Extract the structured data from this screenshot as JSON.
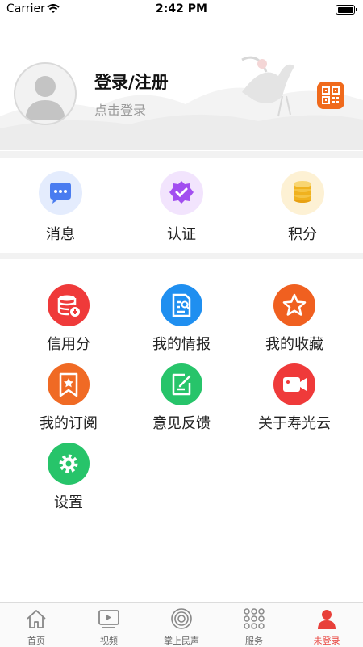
{
  "status_bar": {
    "carrier": "Carrier",
    "time": "2:42 PM"
  },
  "profile": {
    "title": "登录/注册",
    "subtitle": "点击登录"
  },
  "quick_actions": [
    {
      "label": "消息",
      "icon": "chat-bubble-icon",
      "color": "#4a7cf0"
    },
    {
      "label": "认证",
      "icon": "verified-badge-icon",
      "color": "#a24ef0"
    },
    {
      "label": "积分",
      "icon": "coins-icon",
      "color": "#f0b21e"
    }
  ],
  "grid_items": [
    {
      "label": "信用分",
      "icon": "database-icon",
      "color": "#ef3a3a"
    },
    {
      "label": "我的情报",
      "icon": "document-search-icon",
      "color": "#1f8ff0"
    },
    {
      "label": "我的收藏",
      "icon": "star-icon",
      "color": "#f06020"
    },
    {
      "label": "我的订阅",
      "icon": "bookmark-star-icon",
      "color": "#f06a24"
    },
    {
      "label": "意见反馈",
      "icon": "edit-note-icon",
      "color": "#27c46a"
    },
    {
      "label": "关于寿光云",
      "icon": "video-camera-icon",
      "color": "#ef3a3a"
    },
    {
      "label": "设置",
      "icon": "gear-icon",
      "color": "#27c46a"
    }
  ],
  "tab_bar": {
    "tabs": [
      {
        "label": "首页",
        "icon": "home-icon"
      },
      {
        "label": "视频",
        "icon": "video-play-icon"
      },
      {
        "label": "掌上民声",
        "icon": "signal-eye-icon"
      },
      {
        "label": "服务",
        "icon": "grid-dots-icon"
      },
      {
        "label": "未登录",
        "icon": "user-icon"
      }
    ],
    "active_index": 4,
    "active_color": "#e8403a"
  }
}
